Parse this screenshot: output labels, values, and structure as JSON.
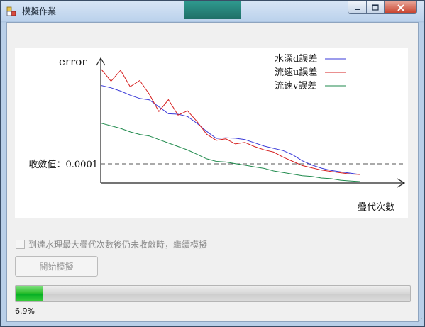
{
  "window": {
    "title": "模擬作業",
    "minimize_icon": "minimize-icon",
    "maximize_icon": "maximize-icon",
    "close_icon": "close-icon"
  },
  "chart_data": {
    "type": "line",
    "ylabel": "error",
    "xlabel": "疊代次數",
    "threshold_label": "收斂值：0.0001",
    "threshold_value": 0.0001,
    "grid": false,
    "legend_position": "top-right",
    "series": [
      {
        "name": "水深d誤差",
        "color": "#3a3ad8",
        "values": [
          0.83,
          0.81,
          0.78,
          0.74,
          0.71,
          0.7,
          0.63,
          0.56,
          0.56,
          0.54,
          0.47,
          0.39,
          0.32,
          0.33,
          0.33,
          0.32,
          0.29,
          0.26,
          0.24,
          0.22,
          0.18,
          0.12,
          0.08,
          0.05,
          0.03,
          0.02,
          0.01,
          0.0
        ]
      },
      {
        "name": "流速u誤差",
        "color": "#d62020",
        "values": [
          1.0,
          0.88,
          1.0,
          0.83,
          0.9,
          0.76,
          0.58,
          0.71,
          0.55,
          0.6,
          0.49,
          0.36,
          0.3,
          0.32,
          0.27,
          0.29,
          0.25,
          0.22,
          0.2,
          0.15,
          0.11,
          0.07,
          0.05,
          0.03,
          0.02,
          0.01,
          0.0,
          0.0
        ]
      },
      {
        "name": "流速v誤差",
        "color": "#1f8a4c",
        "values": [
          0.43,
          0.41,
          0.39,
          0.36,
          0.34,
          0.33,
          0.3,
          0.27,
          0.24,
          0.21,
          0.17,
          0.13,
          0.11,
          0.11,
          0.1,
          0.09,
          0.08,
          0.07,
          0.05,
          0.04,
          0.03,
          0.02,
          0.02,
          0.01,
          0.01,
          0.0,
          0.0,
          0.0
        ]
      }
    ]
  },
  "options": {
    "continue_label": "到達水理最大疊代次數後仍未收斂時，繼續模擬"
  },
  "actions": {
    "start_label": "開始模擬"
  },
  "progress": {
    "fraction": 0.069,
    "text": "6.9%"
  }
}
